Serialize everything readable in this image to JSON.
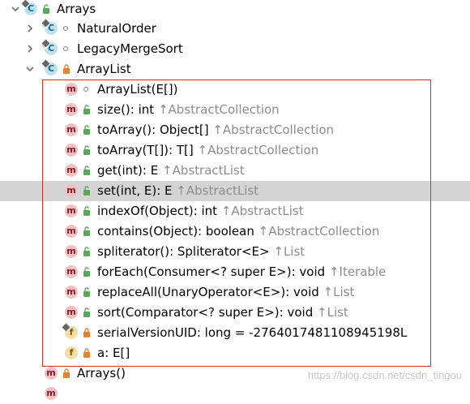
{
  "tree": {
    "root": {
      "label": "Arrays"
    },
    "children": [
      {
        "label": "NaturalOrder"
      },
      {
        "label": "LegacyMergeSort"
      },
      {
        "label": "ArrayList"
      }
    ],
    "members": [
      {
        "name": "ArrayList(E[])",
        "inherit": ""
      },
      {
        "name": "size(): int",
        "inherit": "AbstractCollection"
      },
      {
        "name": "toArray(): Object[]",
        "inherit": "AbstractCollection"
      },
      {
        "name": "toArray(T[]): T[]",
        "inherit": "AbstractCollection"
      },
      {
        "name": "get(int): E",
        "inherit": "AbstractList"
      },
      {
        "name": "set(int, E): E",
        "inherit": "AbstractList"
      },
      {
        "name": "indexOf(Object): int",
        "inherit": "AbstractList"
      },
      {
        "name": "contains(Object): boolean",
        "inherit": "AbstractCollection"
      },
      {
        "name": "spliterator(): Spliterator<E>",
        "inherit": "List"
      },
      {
        "name": "forEach(Consumer<? super E>): void",
        "inherit": "Iterable"
      },
      {
        "name": "replaceAll(UnaryOperator<E>): void",
        "inherit": "List"
      },
      {
        "name": "sort(Comparator<? super E>): void",
        "inherit": "List"
      },
      {
        "name": "serialVersionUID: long = -2764017481108945198L",
        "inherit": ""
      },
      {
        "name": "a: E[]",
        "inherit": ""
      }
    ],
    "after": {
      "label": "Arrays()"
    }
  },
  "icons": {
    "class": "C",
    "method": "m",
    "field": "f",
    "inherit_arrow": "↑"
  },
  "watermark": "https://blog.csdn.net/csdn_tingou",
  "colors": {
    "selection": "#d4d4d4",
    "highlight_box": "#e02a2a",
    "inherited_text": "#8c8c8c"
  }
}
